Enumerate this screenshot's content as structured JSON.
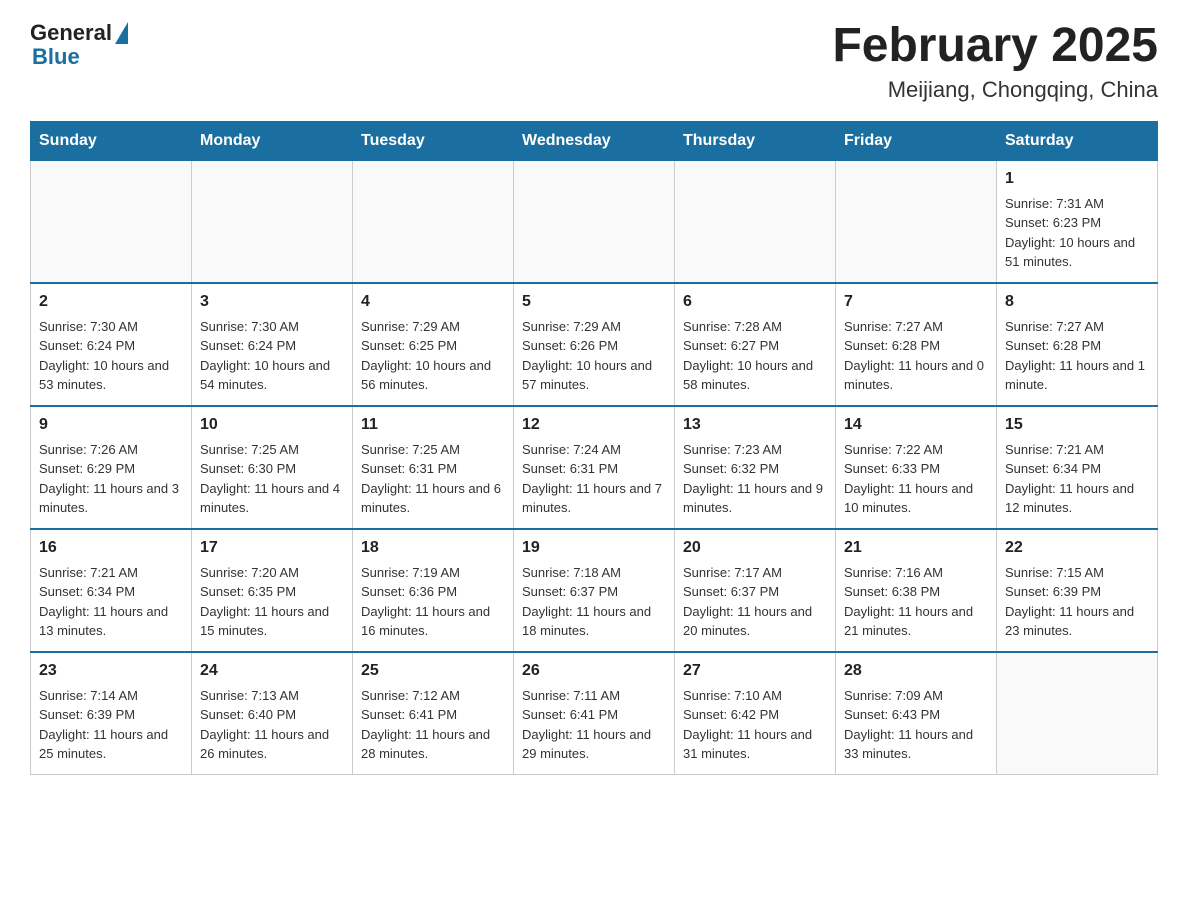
{
  "header": {
    "logo": {
      "general": "General",
      "blue": "Blue"
    },
    "title": "February 2025",
    "subtitle": "Meijiang, Chongqing, China"
  },
  "calendar": {
    "days_of_week": [
      "Sunday",
      "Monday",
      "Tuesday",
      "Wednesday",
      "Thursday",
      "Friday",
      "Saturday"
    ],
    "weeks": [
      [
        {
          "day": "",
          "info": ""
        },
        {
          "day": "",
          "info": ""
        },
        {
          "day": "",
          "info": ""
        },
        {
          "day": "",
          "info": ""
        },
        {
          "day": "",
          "info": ""
        },
        {
          "day": "",
          "info": ""
        },
        {
          "day": "1",
          "info": "Sunrise: 7:31 AM\nSunset: 6:23 PM\nDaylight: 10 hours and 51 minutes."
        }
      ],
      [
        {
          "day": "2",
          "info": "Sunrise: 7:30 AM\nSunset: 6:24 PM\nDaylight: 10 hours and 53 minutes."
        },
        {
          "day": "3",
          "info": "Sunrise: 7:30 AM\nSunset: 6:24 PM\nDaylight: 10 hours and 54 minutes."
        },
        {
          "day": "4",
          "info": "Sunrise: 7:29 AM\nSunset: 6:25 PM\nDaylight: 10 hours and 56 minutes."
        },
        {
          "day": "5",
          "info": "Sunrise: 7:29 AM\nSunset: 6:26 PM\nDaylight: 10 hours and 57 minutes."
        },
        {
          "day": "6",
          "info": "Sunrise: 7:28 AM\nSunset: 6:27 PM\nDaylight: 10 hours and 58 minutes."
        },
        {
          "day": "7",
          "info": "Sunrise: 7:27 AM\nSunset: 6:28 PM\nDaylight: 11 hours and 0 minutes."
        },
        {
          "day": "8",
          "info": "Sunrise: 7:27 AM\nSunset: 6:28 PM\nDaylight: 11 hours and 1 minute."
        }
      ],
      [
        {
          "day": "9",
          "info": "Sunrise: 7:26 AM\nSunset: 6:29 PM\nDaylight: 11 hours and 3 minutes."
        },
        {
          "day": "10",
          "info": "Sunrise: 7:25 AM\nSunset: 6:30 PM\nDaylight: 11 hours and 4 minutes."
        },
        {
          "day": "11",
          "info": "Sunrise: 7:25 AM\nSunset: 6:31 PM\nDaylight: 11 hours and 6 minutes."
        },
        {
          "day": "12",
          "info": "Sunrise: 7:24 AM\nSunset: 6:31 PM\nDaylight: 11 hours and 7 minutes."
        },
        {
          "day": "13",
          "info": "Sunrise: 7:23 AM\nSunset: 6:32 PM\nDaylight: 11 hours and 9 minutes."
        },
        {
          "day": "14",
          "info": "Sunrise: 7:22 AM\nSunset: 6:33 PM\nDaylight: 11 hours and 10 minutes."
        },
        {
          "day": "15",
          "info": "Sunrise: 7:21 AM\nSunset: 6:34 PM\nDaylight: 11 hours and 12 minutes."
        }
      ],
      [
        {
          "day": "16",
          "info": "Sunrise: 7:21 AM\nSunset: 6:34 PM\nDaylight: 11 hours and 13 minutes."
        },
        {
          "day": "17",
          "info": "Sunrise: 7:20 AM\nSunset: 6:35 PM\nDaylight: 11 hours and 15 minutes."
        },
        {
          "day": "18",
          "info": "Sunrise: 7:19 AM\nSunset: 6:36 PM\nDaylight: 11 hours and 16 minutes."
        },
        {
          "day": "19",
          "info": "Sunrise: 7:18 AM\nSunset: 6:37 PM\nDaylight: 11 hours and 18 minutes."
        },
        {
          "day": "20",
          "info": "Sunrise: 7:17 AM\nSunset: 6:37 PM\nDaylight: 11 hours and 20 minutes."
        },
        {
          "day": "21",
          "info": "Sunrise: 7:16 AM\nSunset: 6:38 PM\nDaylight: 11 hours and 21 minutes."
        },
        {
          "day": "22",
          "info": "Sunrise: 7:15 AM\nSunset: 6:39 PM\nDaylight: 11 hours and 23 minutes."
        }
      ],
      [
        {
          "day": "23",
          "info": "Sunrise: 7:14 AM\nSunset: 6:39 PM\nDaylight: 11 hours and 25 minutes."
        },
        {
          "day": "24",
          "info": "Sunrise: 7:13 AM\nSunset: 6:40 PM\nDaylight: 11 hours and 26 minutes."
        },
        {
          "day": "25",
          "info": "Sunrise: 7:12 AM\nSunset: 6:41 PM\nDaylight: 11 hours and 28 minutes."
        },
        {
          "day": "26",
          "info": "Sunrise: 7:11 AM\nSunset: 6:41 PM\nDaylight: 11 hours and 29 minutes."
        },
        {
          "day": "27",
          "info": "Sunrise: 7:10 AM\nSunset: 6:42 PM\nDaylight: 11 hours and 31 minutes."
        },
        {
          "day": "28",
          "info": "Sunrise: 7:09 AM\nSunset: 6:43 PM\nDaylight: 11 hours and 33 minutes."
        },
        {
          "day": "",
          "info": ""
        }
      ]
    ]
  }
}
